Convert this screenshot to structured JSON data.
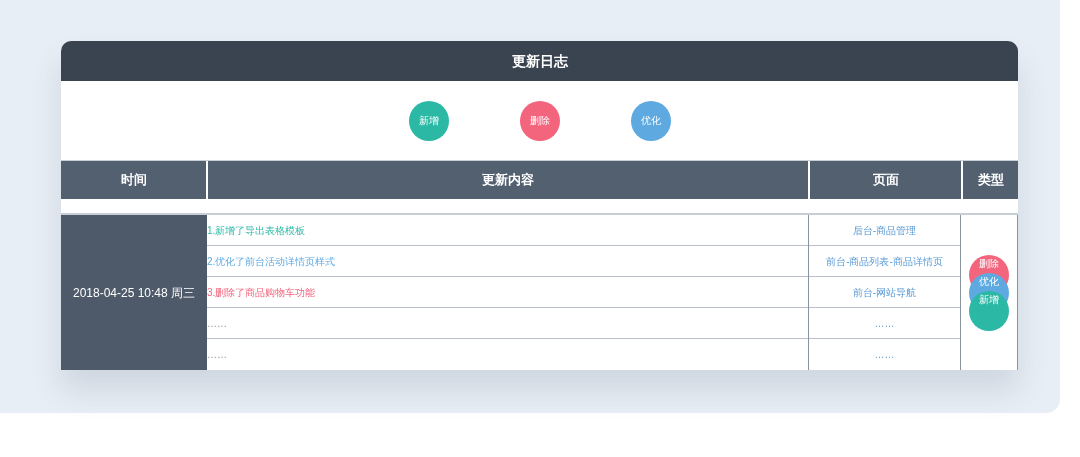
{
  "title": "更新日志",
  "legend": [
    {
      "label": "新增",
      "color": "#2bb8a5"
    },
    {
      "label": "删除",
      "color": "#f3647d"
    },
    {
      "label": "优化",
      "color": "#5eaae0"
    }
  ],
  "table": {
    "columns": [
      "时间",
      "更新内容",
      "页面",
      "类型"
    ],
    "time": "2018-04-25 10:48 周三",
    "rows": [
      {
        "content": "1.新增了导出表格模板",
        "page": "后台-商品管理",
        "kind": "added"
      },
      {
        "content": "2.优化了前台活动详情页样式",
        "page": "前台-商品列表-商品详情页",
        "kind": "optimized"
      },
      {
        "content": "3.删除了商品购物车功能",
        "page": "前台-网站导航",
        "kind": "deleted"
      },
      {
        "content": "……",
        "page": "……",
        "kind": "pending"
      },
      {
        "content": "……",
        "page": "……",
        "kind": "pending"
      }
    ],
    "types": [
      {
        "label": "删除",
        "color": "#f3647d"
      },
      {
        "label": "优化",
        "color": "#5eaae0"
      },
      {
        "label": "新增",
        "color": "#2bb8a5"
      }
    ]
  }
}
